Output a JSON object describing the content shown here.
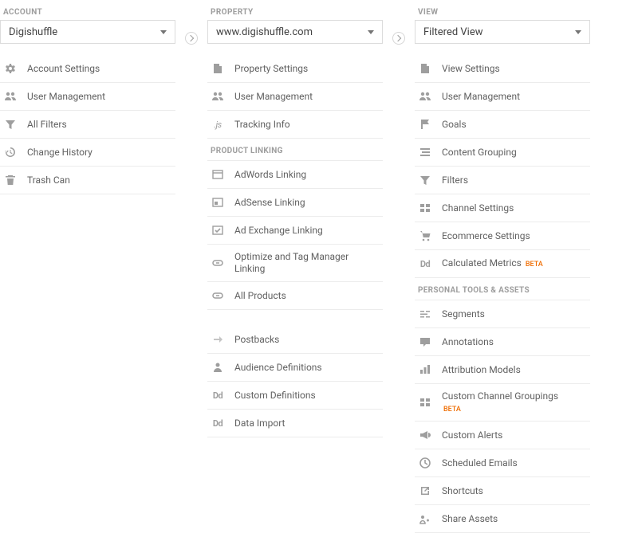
{
  "account": {
    "header": "ACCOUNT",
    "selected": "Digishuffle",
    "items": [
      {
        "label": "Account Settings",
        "icon": "settings"
      },
      {
        "label": "User Management",
        "icon": "users"
      },
      {
        "label": "All Filters",
        "icon": "filter"
      },
      {
        "label": "Change History",
        "icon": "history"
      },
      {
        "label": "Trash Can",
        "icon": "trash"
      }
    ]
  },
  "property": {
    "header": "PROPERTY",
    "selected": "www.digishuffle.com",
    "items": [
      {
        "label": "Property Settings",
        "icon": "doc"
      },
      {
        "label": "User Management",
        "icon": "users"
      },
      {
        "label": "Tracking Info",
        "icon": "js"
      }
    ],
    "product_linking_header": "PRODUCT LINKING",
    "product_linking": [
      {
        "label": "AdWords Linking",
        "icon": "adwords"
      },
      {
        "label": "AdSense Linking",
        "icon": "adsense"
      },
      {
        "label": "Ad Exchange Linking",
        "icon": "adexchange"
      },
      {
        "label": "Optimize and Tag Manager Linking",
        "icon": "link"
      },
      {
        "label": "All Products",
        "icon": "link"
      }
    ],
    "more": [
      {
        "label": "Postbacks",
        "icon": "postbacks"
      },
      {
        "label": "Audience Definitions",
        "icon": "audience"
      },
      {
        "label": "Custom Definitions",
        "icon": "dd"
      },
      {
        "label": "Data Import",
        "icon": "dd"
      }
    ]
  },
  "view": {
    "header": "VIEW",
    "selected": "Filtered View",
    "items": [
      {
        "label": "View Settings",
        "icon": "doc"
      },
      {
        "label": "User Management",
        "icon": "users"
      },
      {
        "label": "Goals",
        "icon": "flag"
      },
      {
        "label": "Content Grouping",
        "icon": "content"
      },
      {
        "label": "Filters",
        "icon": "filter"
      },
      {
        "label": "Channel Settings",
        "icon": "channel"
      },
      {
        "label": "Ecommerce Settings",
        "icon": "cart"
      },
      {
        "label": "Calculated Metrics",
        "icon": "dd",
        "badge": "BETA"
      }
    ],
    "personal_header": "PERSONAL TOOLS & ASSETS",
    "personal": [
      {
        "label": "Segments",
        "icon": "segments"
      },
      {
        "label": "Annotations",
        "icon": "annotation"
      },
      {
        "label": "Attribution Models",
        "icon": "bars"
      },
      {
        "label": "Custom Channel Groupings",
        "icon": "channel",
        "badge": "BETA",
        "badge_below": true
      },
      {
        "label": "Custom Alerts",
        "icon": "megaphone"
      },
      {
        "label": "Scheduled Emails",
        "icon": "clock"
      },
      {
        "label": "Shortcuts",
        "icon": "shortcut"
      },
      {
        "label": "Share Assets",
        "icon": "share"
      }
    ]
  }
}
